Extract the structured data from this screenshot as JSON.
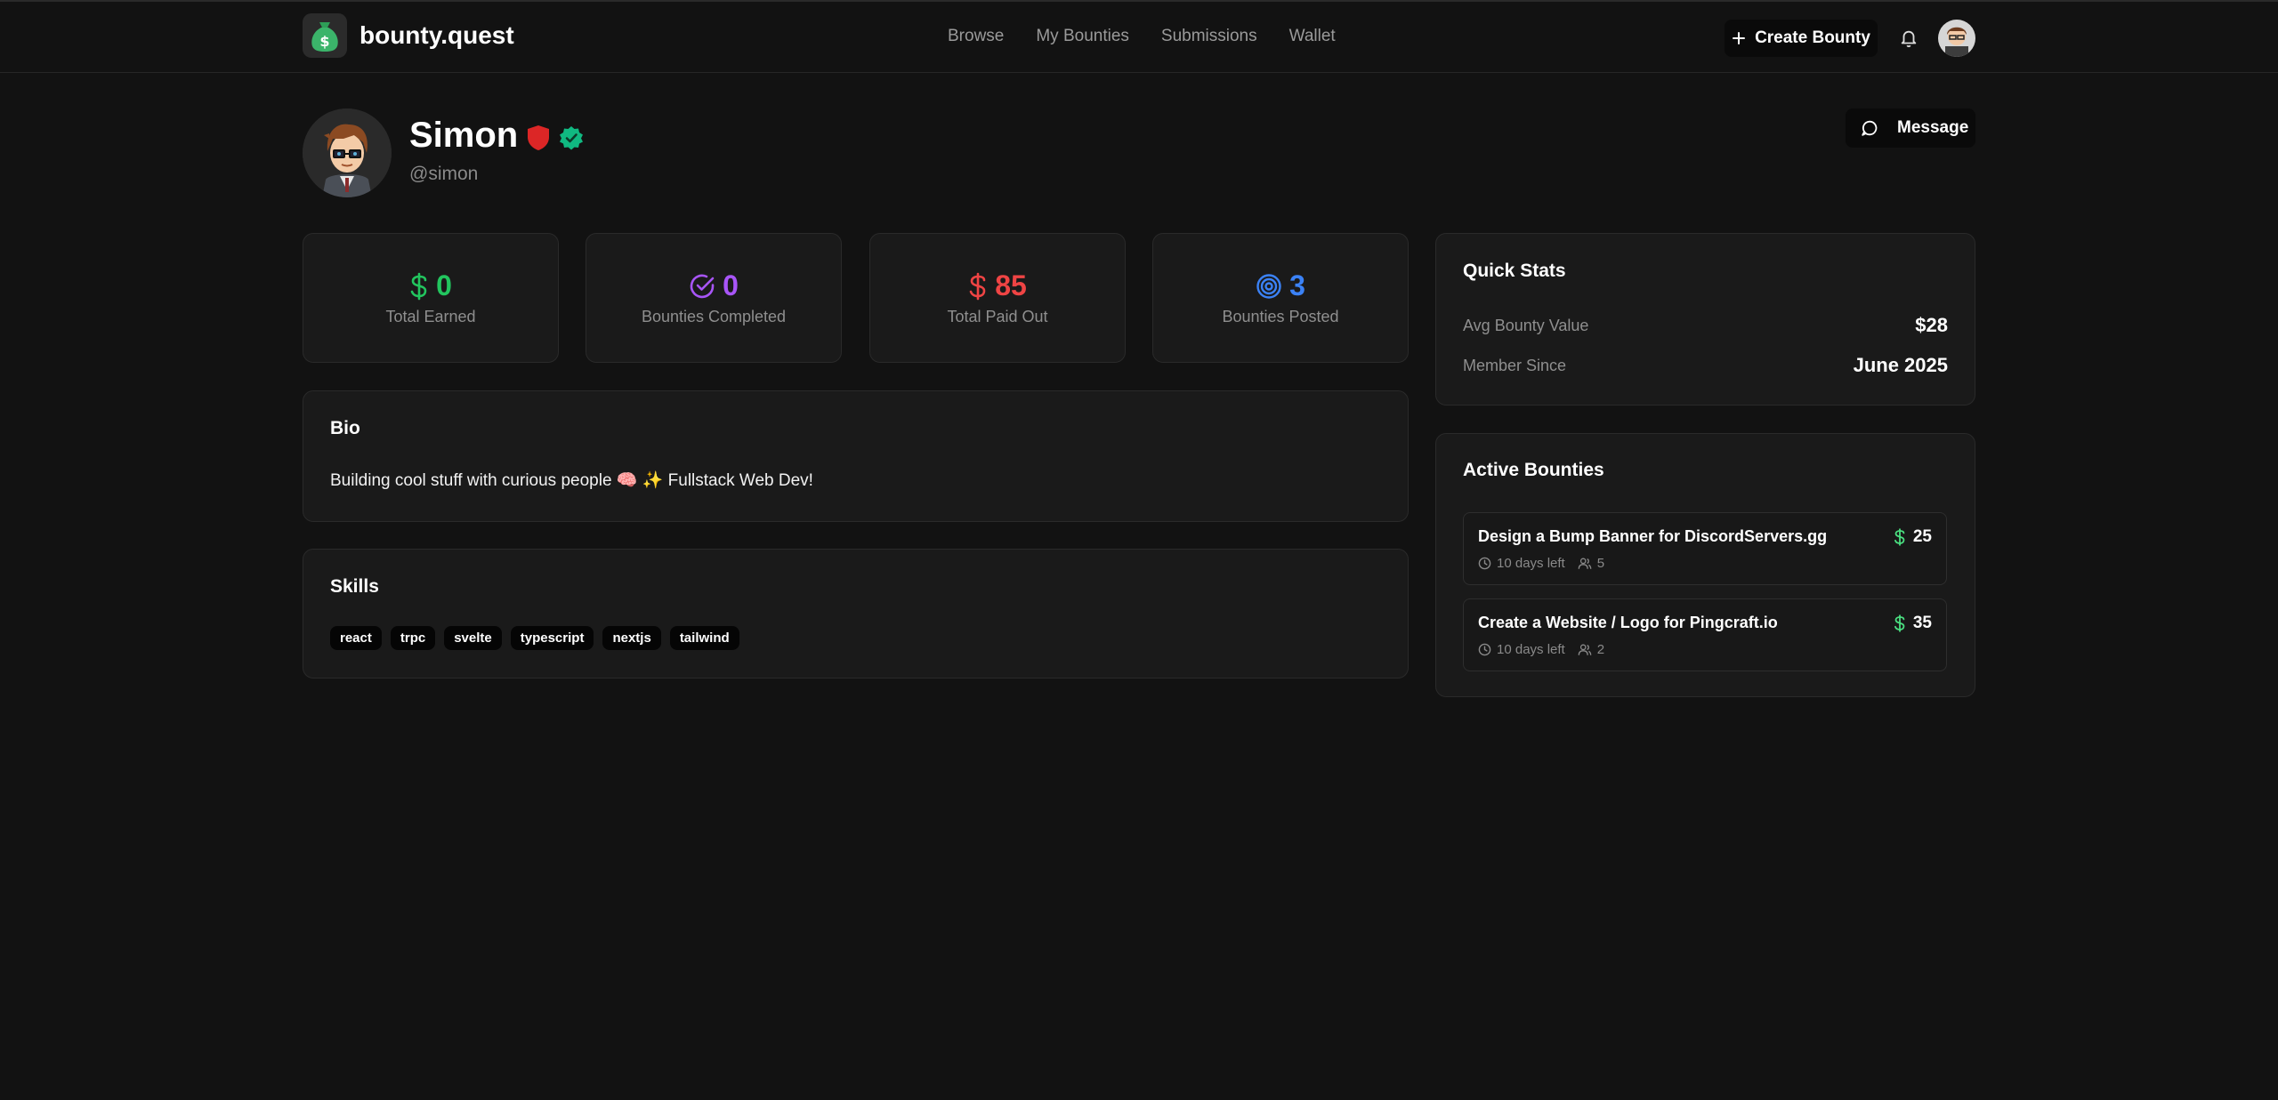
{
  "header": {
    "brand": "bounty.quest",
    "nav": [
      "Browse",
      "My Bounties",
      "Submissions",
      "Wallet"
    ],
    "create_label": "Create Bounty"
  },
  "profile": {
    "name": "Simon",
    "handle": "@simon",
    "message_label": "Message"
  },
  "stats": [
    {
      "value": "0",
      "label": "Total Earned",
      "color": "#22c55e",
      "icon": "dollar-icon"
    },
    {
      "value": "0",
      "label": "Bounties Completed",
      "color": "#a855f7",
      "icon": "check-circle-icon"
    },
    {
      "value": "85",
      "label": "Total Paid Out",
      "color": "#ef4444",
      "icon": "dollar-icon"
    },
    {
      "value": "3",
      "label": "Bounties Posted",
      "color": "#3b82f6",
      "icon": "target-icon"
    }
  ],
  "bio": {
    "title": "Bio",
    "text": "Building cool stuff with curious people 🧠 ✨ Fullstack Web Dev!"
  },
  "skills": {
    "title": "Skills",
    "items": [
      "react",
      "trpc",
      "svelte",
      "typescript",
      "nextjs",
      "tailwind"
    ]
  },
  "quick_stats": {
    "title": "Quick Stats",
    "rows": [
      {
        "label": "Avg Bounty Value",
        "value": "$28"
      },
      {
        "label": "Member Since",
        "value": "June 2025"
      }
    ]
  },
  "active_bounties": {
    "title": "Active Bounties",
    "items": [
      {
        "title": "Design a Bump Banner for DiscordServers.gg",
        "time": "10 days left",
        "participants": "5",
        "amount": "25"
      },
      {
        "title": "Create a Website / Logo for Pingcraft.io",
        "time": "10 days left",
        "participants": "2",
        "amount": "35"
      }
    ]
  },
  "colors": {
    "accent_green": "#22c55e",
    "shield_red": "#dc2626",
    "verified_green": "#10b981",
    "bounty_dollar_green": "#4ade80"
  }
}
